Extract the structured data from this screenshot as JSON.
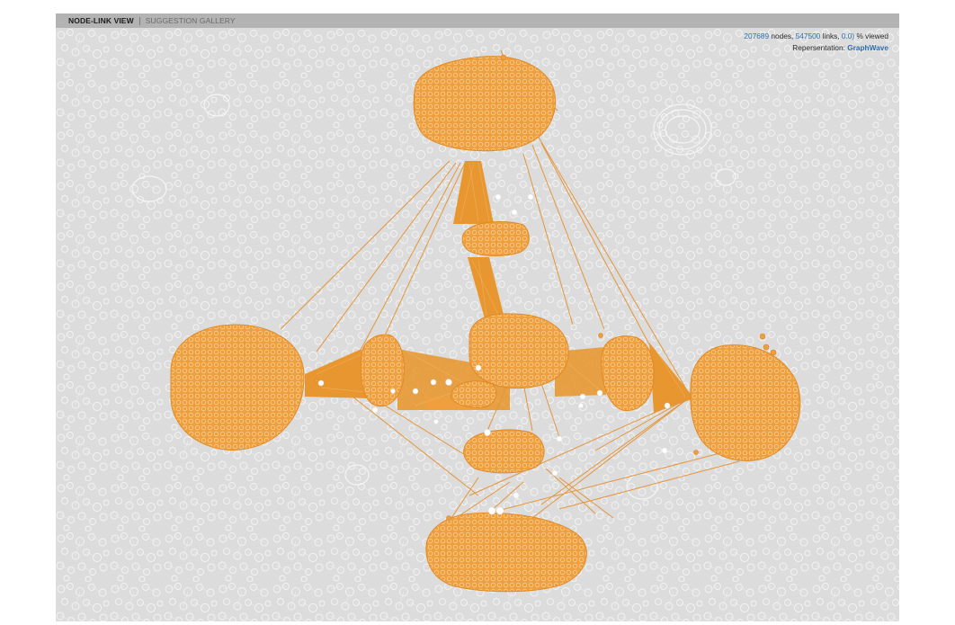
{
  "tabs": [
    {
      "label": "NODE-LINK VIEW",
      "active": true
    },
    {
      "label": "SUGGESTION GALLERY",
      "active": false
    }
  ],
  "stats": {
    "nodes_count": "207689",
    "nodes_label": "nodes,",
    "links_count": "547500",
    "links_label": "links,",
    "viewed_value": "0.0)",
    "viewed_label": "% viewed",
    "representation_label": "Repersentation:",
    "representation_value": "GraphWave"
  },
  "colors": {
    "cluster": "#ef9f3e",
    "cluster_edge": "#e08a25",
    "background_node": "#f2f2f2",
    "canvas_bg": "#dcdcdc",
    "accent": "#2d6db0"
  }
}
